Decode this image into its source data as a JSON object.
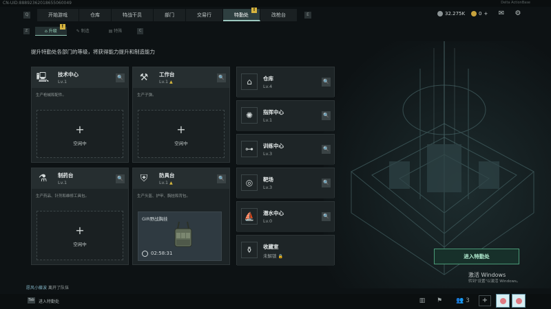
{
  "top": {
    "uid": "CN-UID:88892362018655060049",
    "right_text": "Delta ActionBase"
  },
  "main_nav": {
    "left_key": "Q",
    "right_key": "E",
    "tabs": [
      {
        "label": "开始游戏",
        "active": false
      },
      {
        "label": "仓库",
        "active": false
      },
      {
        "label": "特战干员",
        "active": false
      },
      {
        "label": "部门",
        "active": false
      },
      {
        "label": "交易行",
        "active": false
      },
      {
        "label": "特勤处",
        "active": true,
        "badge": "!"
      },
      {
        "label": "改枪台",
        "active": false
      }
    ]
  },
  "currency": {
    "silver": "32.275K",
    "gold": "0",
    "gold_add": "+"
  },
  "sub_nav": {
    "left_key": "Z",
    "right_key": "C",
    "tabs": [
      {
        "label": "升级",
        "active": true,
        "badge": "!"
      },
      {
        "label": "制造",
        "active": false
      },
      {
        "label": "特殊",
        "active": false
      }
    ]
  },
  "hint": "提升特勤处各部门的等级，将获得能力提升和制造能力",
  "workbenches": [
    {
      "name": "技术中心",
      "level": "Lv.1",
      "desc": "生产枪械和配件。",
      "slot_plus": "+",
      "slot_label": "空闲中",
      "icon": "monitor-icon"
    },
    {
      "name": "工作台",
      "level": "Lv.1",
      "upgrade": "▲",
      "desc": "生产子弹。",
      "slot_plus": "+",
      "slot_label": "空闲中",
      "icon": "tools-icon"
    },
    {
      "name": "制药台",
      "level": "Lv.1",
      "desc": "生产药品、针剂和维修工具包。",
      "slot_plus": "+",
      "slot_label": "空闲中",
      "icon": "microscope-icon"
    },
    {
      "name": "防具台",
      "level": "Lv.1",
      "upgrade": "▲",
      "desc": "生产头盔、护甲、胸挂和背包。",
      "item_name": "GIR野战胸挂",
      "timer": "02:58:31",
      "icon": "armor-icon"
    }
  ],
  "facilities": [
    {
      "name": "仓库",
      "level": "Lv.4",
      "icon": "warehouse-icon"
    },
    {
      "name": "指挥中心",
      "level": "Lv.1",
      "icon": "chip-icon"
    },
    {
      "name": "训练中心",
      "level": "Lv.3",
      "icon": "dumbbell-icon"
    },
    {
      "name": "靶场",
      "level": "Lv.3",
      "icon": "target-icon"
    },
    {
      "name": "潜水中心",
      "level": "Lv.0",
      "icon": "diving-icon"
    },
    {
      "name": "收藏室",
      "level": "未解锁",
      "locked": true,
      "icon": "collection-icon"
    }
  ],
  "enter_button": "进入特勤处",
  "windows": {
    "line1": "激活 Windows",
    "line2": "转到\"设置\"以激活 Windows。"
  },
  "chat": {
    "name": "愿风小藤波",
    "text": "离开了队伍"
  },
  "bottom": {
    "key": "Tab",
    "label": "进入特勤处",
    "friends_count": "3",
    "add": "+"
  },
  "colors": {
    "accent_gold": "#d7b53f",
    "active_tab": "#2e3f40",
    "enter_green": "#4b9b78"
  }
}
